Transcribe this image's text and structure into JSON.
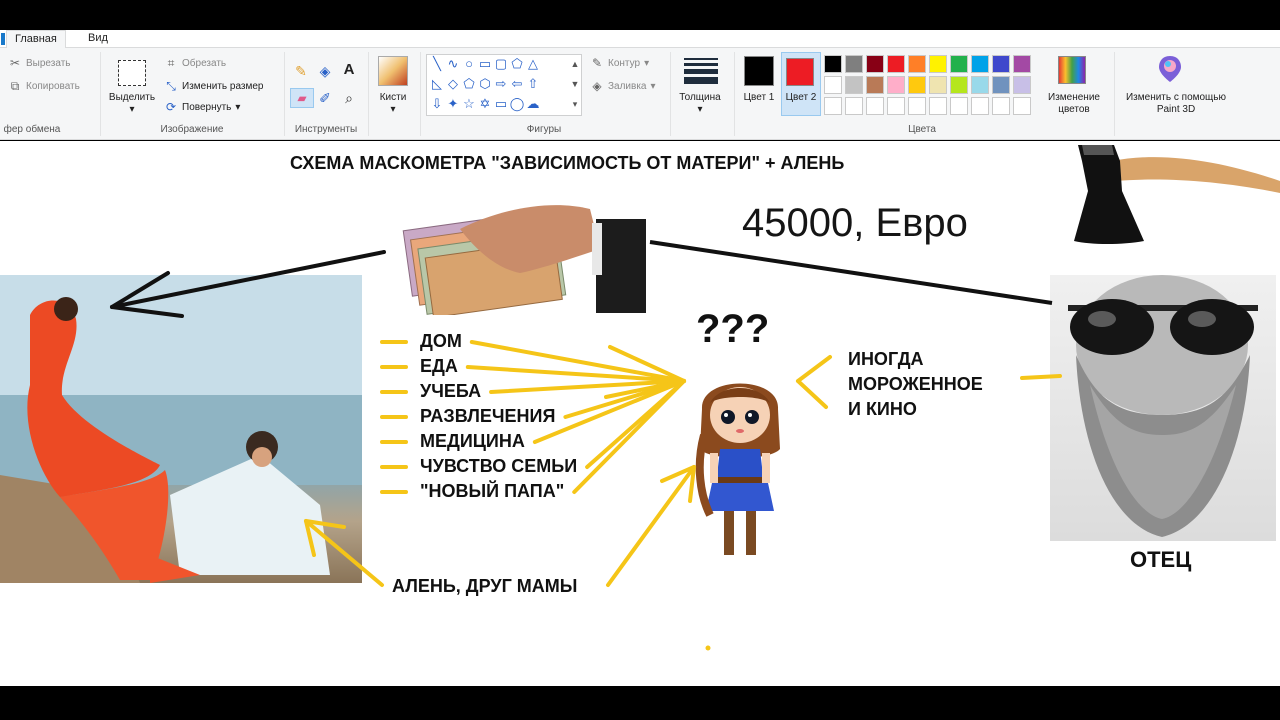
{
  "ribbon": {
    "tabs": [
      {
        "label": "Главная"
      },
      {
        "label": "Вид"
      }
    ],
    "clipboard": {
      "cut": "Вырезать",
      "copy": "Копировать",
      "label": "фер обмена"
    },
    "image": {
      "select": "Выделить",
      "crop": "Обрезать",
      "resize": "Изменить размер",
      "rotate": "Повернуть",
      "label": "Изображение"
    },
    "tools": {
      "label": "Инструменты"
    },
    "brushes": {
      "label": "Кисти"
    },
    "shapes": {
      "outline": "Контур",
      "fill": "Заливка",
      "label": "Фигуры"
    },
    "thickness": {
      "label": "Толщина"
    },
    "colors": {
      "color1": "Цвет 1",
      "color2": "Цвет 2",
      "label": "Цвета",
      "edit": "Изменение цветов",
      "paint3d": "Изменить с помощью Paint 3D",
      "color1_value": "#000000",
      "color2_value": "#ed1c24",
      "palette_row1": [
        "#000000",
        "#7f7f7f",
        "#880015",
        "#ed1c24",
        "#ff7f27",
        "#fff200",
        "#22b14c",
        "#00a2e8",
        "#3f48cc",
        "#a349a4"
      ],
      "palette_row2": [
        "#ffffff",
        "#c3c3c3",
        "#b97a57",
        "#ffaec9",
        "#ffc90e",
        "#efe4b0",
        "#b5e61d",
        "#99d9ea",
        "#7092be",
        "#c8bfe7"
      ]
    }
  },
  "canvas": {
    "title": "СХЕМА МАСКОМЕТРА \"ЗАВИСИМОСТЬ ОТ МАТЕРИ\" + АЛЕНЬ",
    "amount": "45000, Евро",
    "question": "???",
    "expenses": [
      "ДОМ",
      "ЕДА",
      "УЧЕБА",
      "РАЗВЛЕЧЕНИЯ",
      "МЕДИЦИНА",
      "ЧУВСТВО СЕМЬИ",
      "\"НОВЫЙ ПАПА\""
    ],
    "father_gifts": [
      "ИНОГДА",
      "МОРОЖЕННОЕ",
      "И КИНО"
    ],
    "father_label": "ОТЕЦ",
    "alen_label": "АЛЕНЬ, ДРУГ МАМЫ",
    "arrow_color": "#f5c518"
  }
}
